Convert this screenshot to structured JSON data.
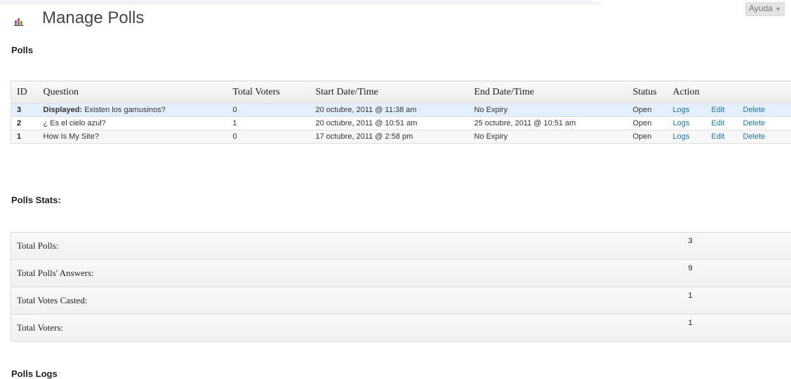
{
  "header": {
    "title": "Manage Polls",
    "help_label": "Ayuda",
    "help_caret": "▼",
    "icon": "chart-bars-icon",
    "icon_colors": [
      "#4a86c5",
      "#d9534f",
      "#6aa84f"
    ]
  },
  "polls_section": {
    "title": "Polls",
    "columns": [
      "ID",
      "Question",
      "Total Voters",
      "Start Date/Time",
      "End Date/Time",
      "Status",
      "Action"
    ],
    "rows": [
      {
        "id": "3",
        "question_prefix": "Displayed:",
        "question": "Existen los gamusinos?",
        "total_voters": "0",
        "start": "20 octubre, 2011 @ 11:38 am",
        "end": "No Expiry",
        "status": "Open",
        "logs": "Logs",
        "edit": "Edit",
        "delete": "Delete"
      },
      {
        "id": "2",
        "question_prefix": "",
        "question": "¿ Es el cielo azul?",
        "total_voters": "1",
        "start": "20 octubre, 2011 @ 10:51 am",
        "end": "25 octubre, 2011 @ 10:51 am",
        "status": "Open",
        "logs": "Logs",
        "edit": "Edit",
        "delete": "Delete"
      },
      {
        "id": "1",
        "question_prefix": "",
        "question": "How Is My Site?",
        "total_voters": "0",
        "start": "17 octubre, 2011 @ 2:58 pm",
        "end": "No Expiry",
        "status": "Open",
        "logs": "Logs",
        "edit": "Edit",
        "delete": "Delete"
      }
    ]
  },
  "stats_section": {
    "title": "Polls Stats:",
    "rows": [
      {
        "label": "Total Polls:",
        "value": "3"
      },
      {
        "label": "Total Polls' Answers:",
        "value": "9"
      },
      {
        "label": "Total Votes Casted:",
        "value": "1"
      },
      {
        "label": "Total Voters:",
        "value": "1"
      }
    ]
  },
  "logs_section": {
    "title": "Polls Logs"
  },
  "colors": {
    "link": "#21759b",
    "highlight_row": "#e3effb",
    "border": "#dfdfdf"
  }
}
